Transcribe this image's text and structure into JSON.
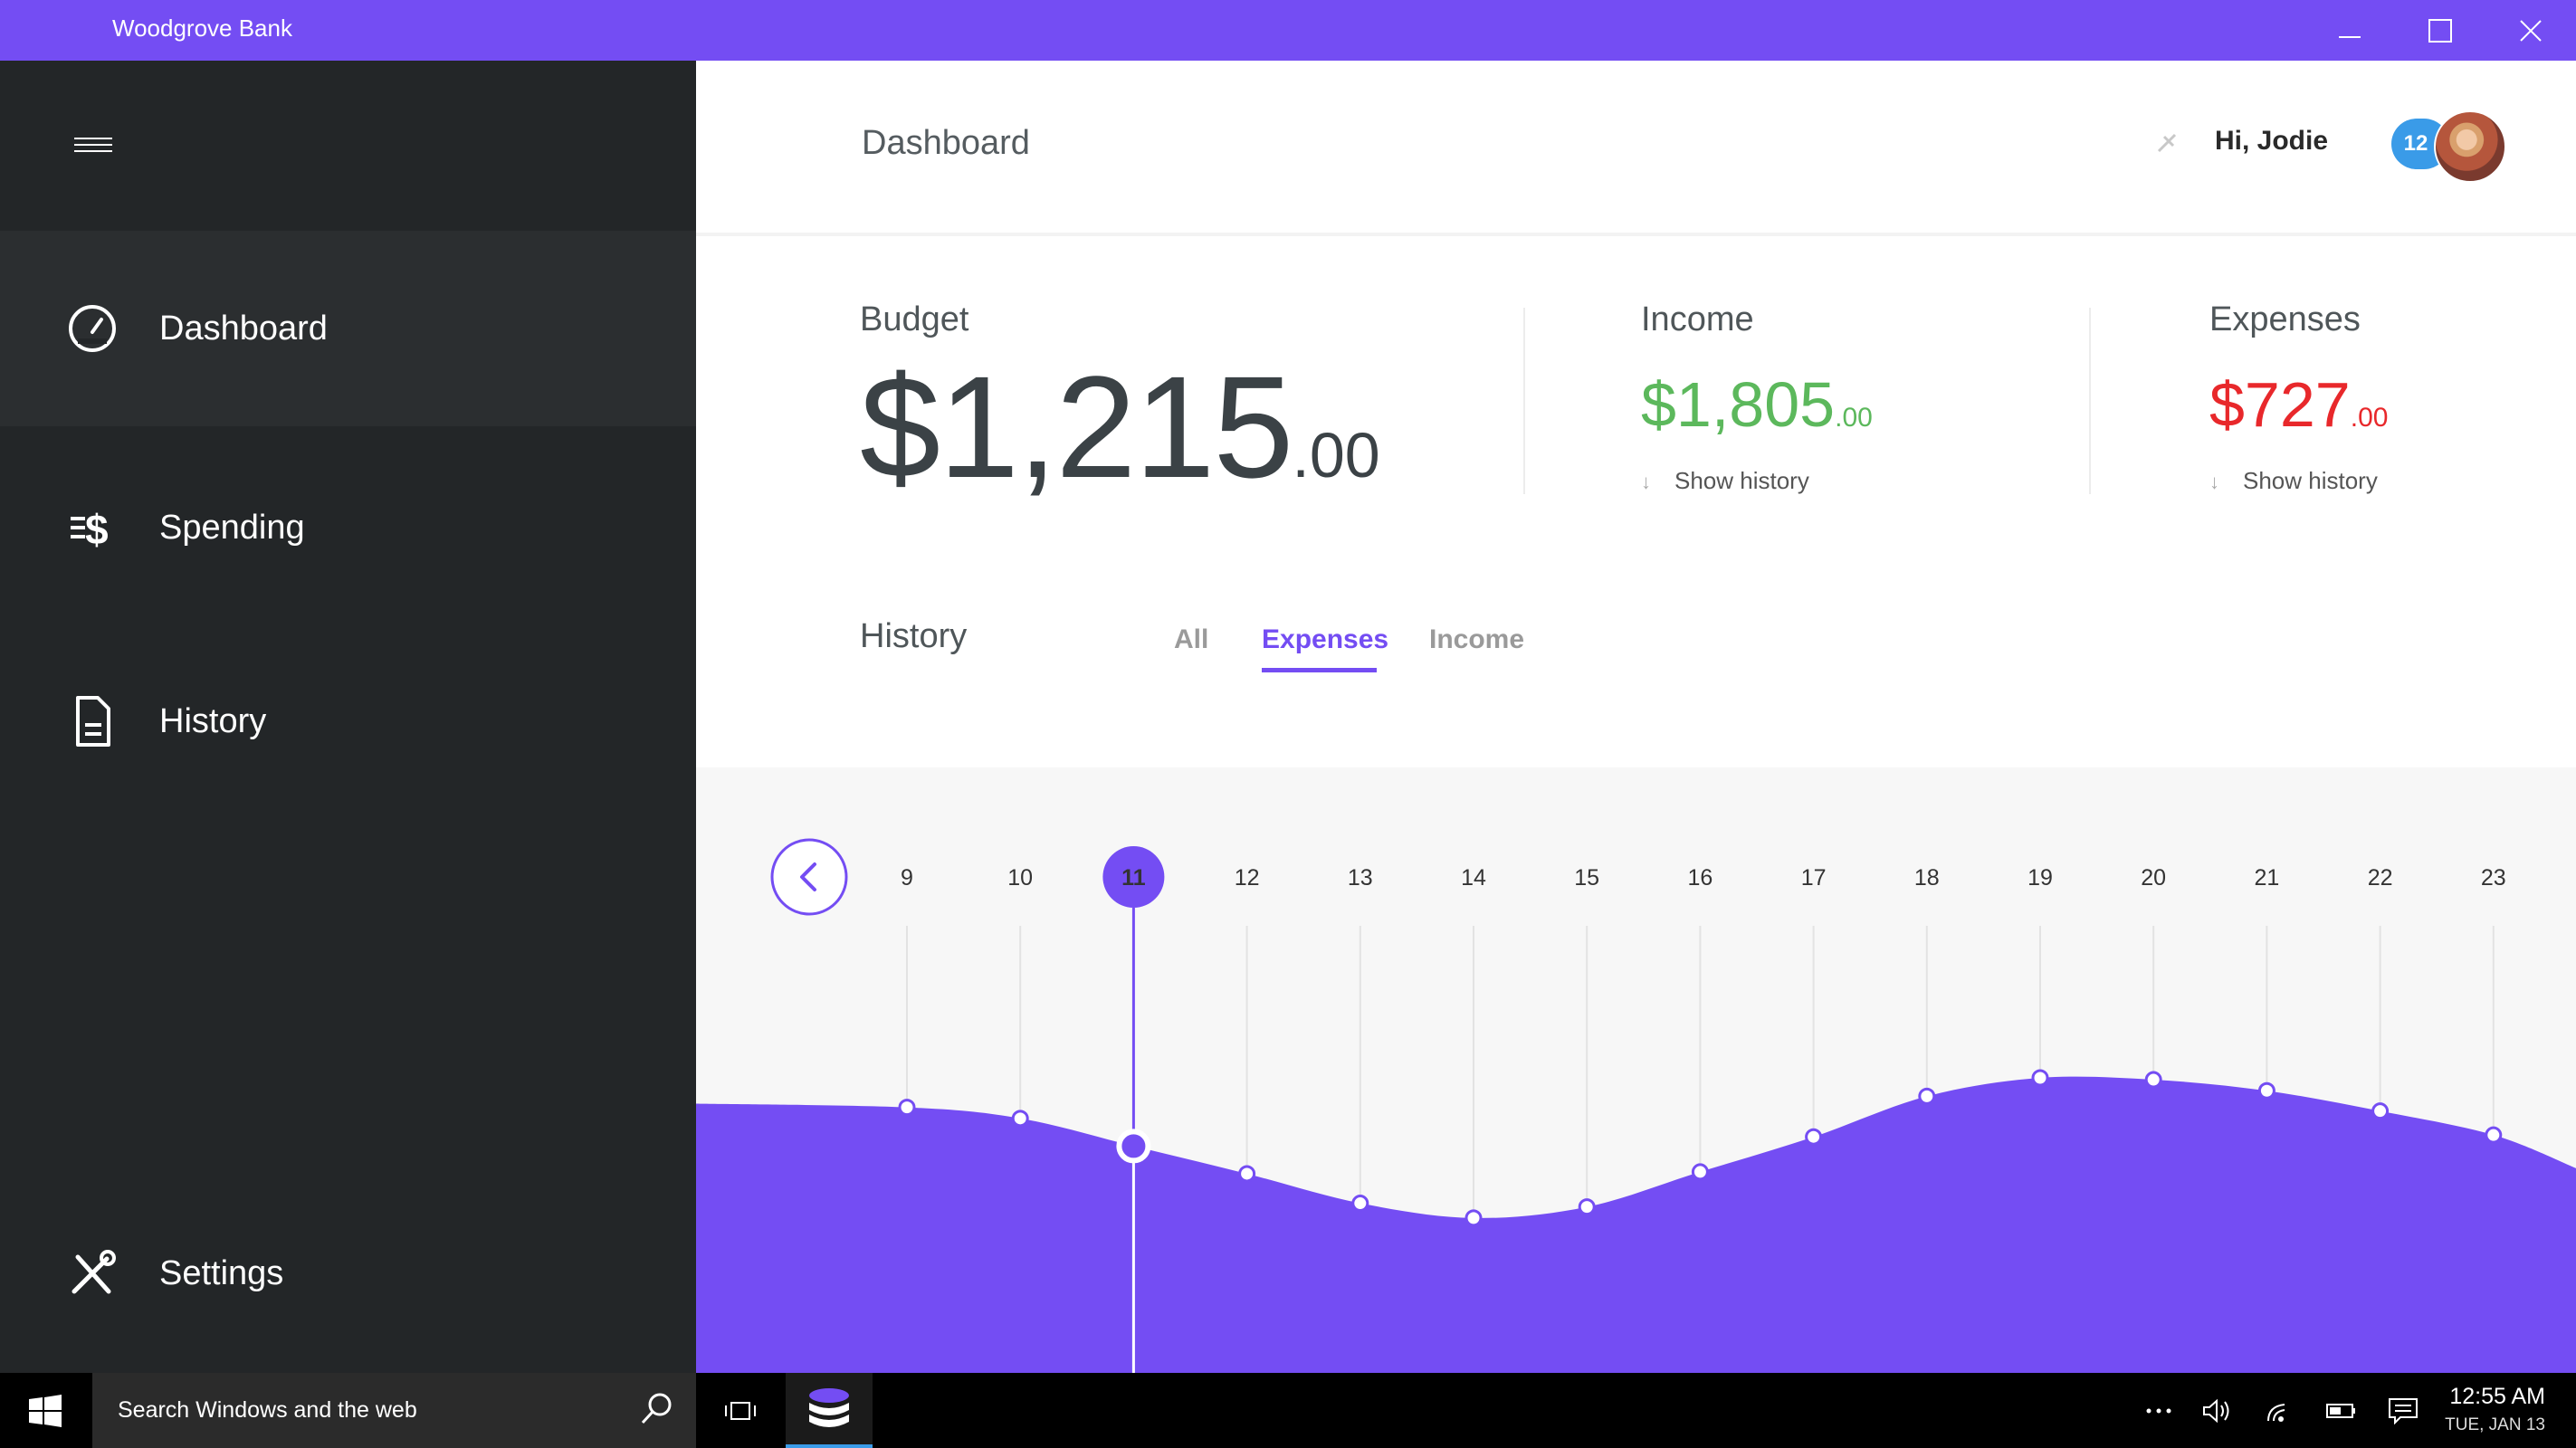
{
  "window": {
    "title": "Woodgrove Bank",
    "accent_color": "#744df3"
  },
  "sidebar": {
    "menu_icon": "hamburger-icon",
    "items": [
      {
        "label": "Dashboard",
        "icon": "speedometer-icon",
        "active": true
      },
      {
        "label": "Spending",
        "icon": "dollar-list-icon",
        "active": false
      },
      {
        "label": "History",
        "icon": "document-icon",
        "active": false
      }
    ],
    "settings": {
      "label": "Settings",
      "icon": "tools-icon"
    }
  },
  "header": {
    "title": "Dashboard",
    "greeting": "Hi, Jodie",
    "notification_count": "12"
  },
  "budget": {
    "label": "Budget",
    "dollars": "$1,215",
    "cents": ".00"
  },
  "income": {
    "label": "Income",
    "dollars": "$1,805",
    "cents": ".00",
    "link": "Show history",
    "color": "#5cb85c"
  },
  "expenses": {
    "label": "Expenses",
    "dollars": "$727",
    "cents": ".00",
    "link": "Show history",
    "color": "#e8282b"
  },
  "history": {
    "title": "History",
    "tabs": [
      {
        "label": "All",
        "active": false
      },
      {
        "label": "Expenses",
        "active": true
      },
      {
        "label": "Income",
        "active": false
      }
    ]
  },
  "chart_data": {
    "type": "area",
    "x": [
      "9",
      "10",
      "11",
      "12",
      "13",
      "14",
      "15",
      "16",
      "17",
      "18",
      "19",
      "20",
      "21",
      "22",
      "23"
    ],
    "values": [
      64,
      58,
      43,
      28,
      12,
      4,
      10,
      29,
      48,
      70,
      80,
      79,
      73,
      62,
      49
    ],
    "ylim": [
      -80,
      160
    ],
    "selected": "11",
    "grid": true,
    "color": "#744df3"
  },
  "taskbar": {
    "search_placeholder": "Search Windows and the web",
    "time": "12:55 AM",
    "date": "TUE, JAN 13"
  }
}
